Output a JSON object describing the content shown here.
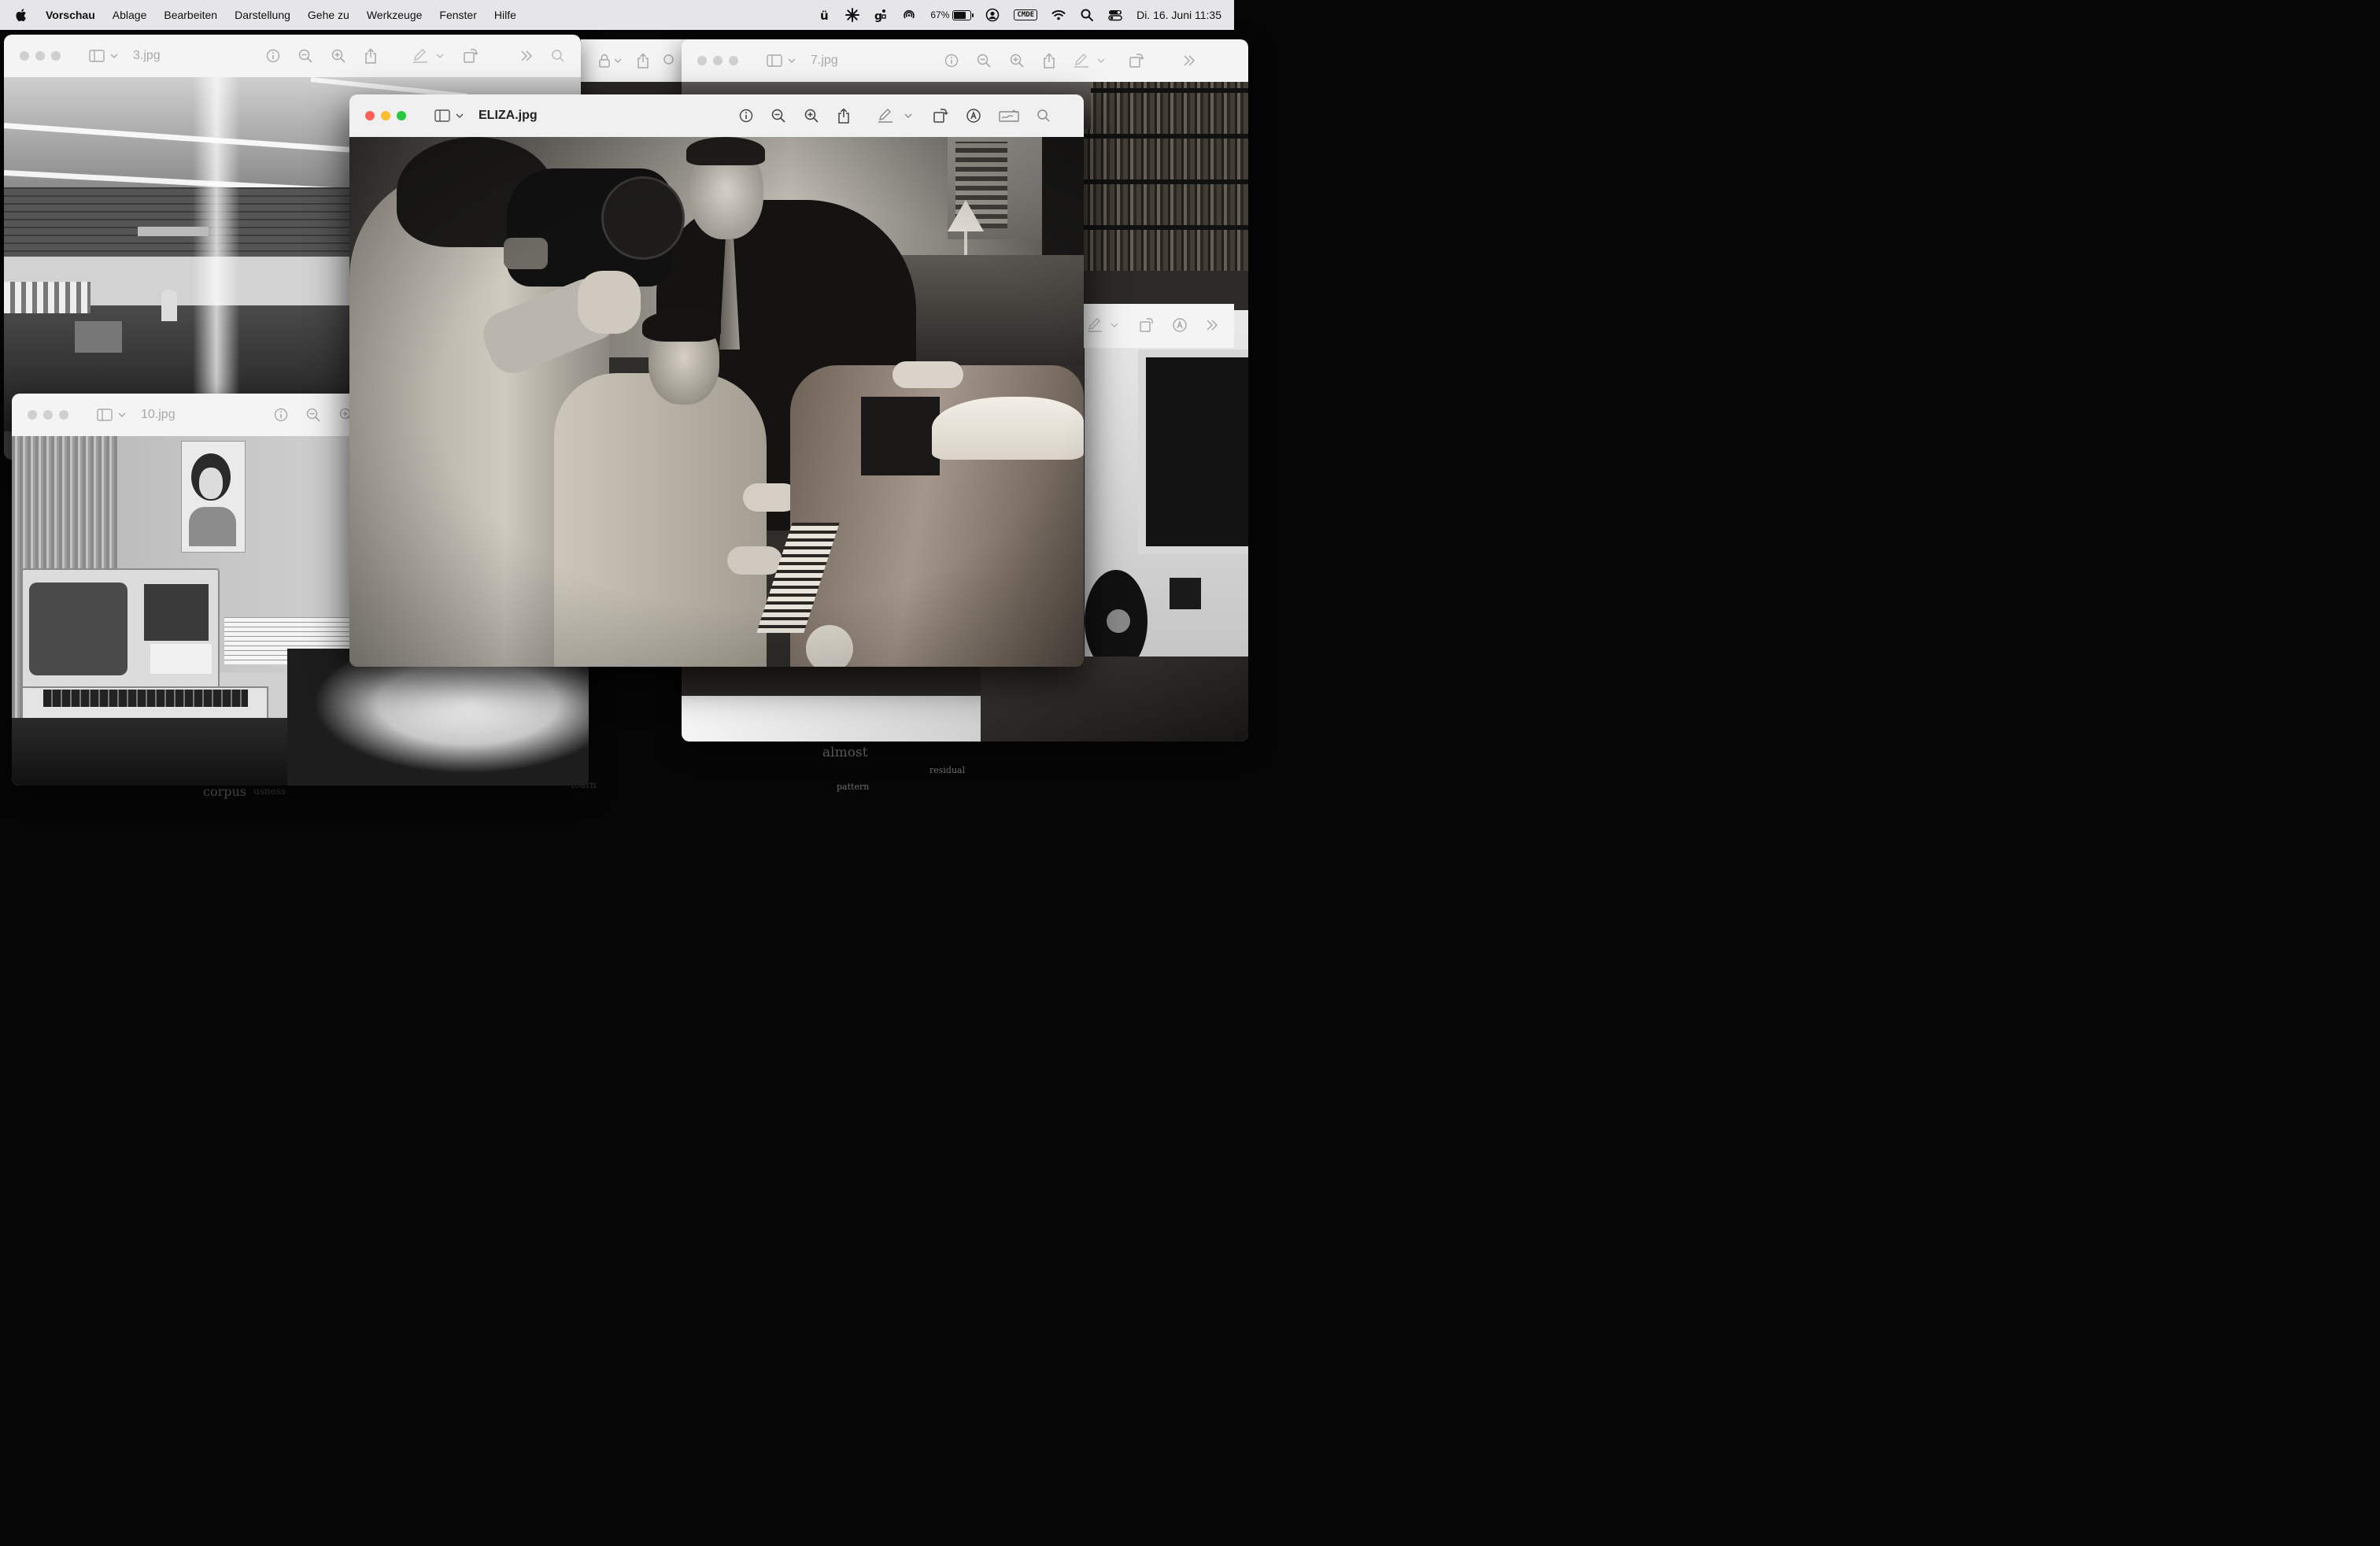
{
  "menubar": {
    "app_name": "Vorschau",
    "menus": [
      "Ablage",
      "Bearbeiten",
      "Darstellung",
      "Gehe zu",
      "Werkzeuge",
      "Fenster",
      "Hilfe"
    ],
    "battery_percent": "67%",
    "battery_level": 0.67,
    "cmde_label": "CMDE",
    "datetime": "Di. 16. Juni  11:35"
  },
  "windows": {
    "w3": {
      "title": "3.jpg"
    },
    "w7": {
      "title": "7.jpg"
    },
    "w10": {
      "title": "10.jpg"
    },
    "eliza": {
      "title": "ELIZA.jpg"
    }
  },
  "background_words": {
    "almost": "almost",
    "residual": "residual",
    "pattern": "pattern",
    "corpus": "corpus",
    "usness": "usness",
    "learn": "learn"
  },
  "colors": {
    "close": "#ff5f57",
    "minimize": "#febc2e",
    "zoom": "#28c840",
    "inactive_light": "#cfcfcf"
  },
  "icons": [
    "apple-icon",
    "sidebar-icon",
    "info-icon",
    "zoom-out-icon",
    "zoom-in-icon",
    "share-icon",
    "markup-pen-icon",
    "rotate-icon",
    "annotate-icon",
    "signature-icon",
    "search-icon",
    "lock-icon",
    "more-chevrons-icon"
  ]
}
